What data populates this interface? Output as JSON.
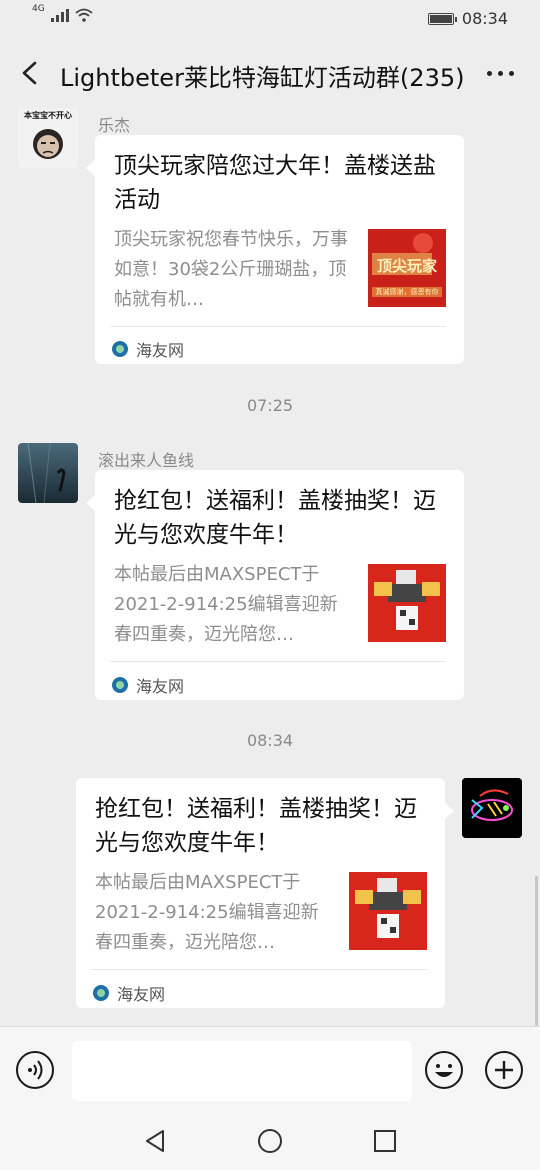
{
  "status": {
    "network": "4G",
    "time": "08:34"
  },
  "nav": {
    "title": "Lightbeter莱比特海缸灯活动群(235)"
  },
  "messages": [
    {
      "sender": "乐杰",
      "avatar_text": "本宝宝不开心",
      "card": {
        "title": "顶尖玩家陪您过大年！盖楼送盐活动",
        "desc": "顶尖玩家祝您春节快乐，万事如意！30袋2公斤珊瑚盐，顶帖就有机…",
        "thumb_text_top": "顶尖玩家",
        "thumb_text_bottom": "真诚感谢，感恩有你",
        "source": "海友网"
      }
    },
    {
      "sender": "滚出来人鱼线",
      "card": {
        "title": "抢红包！送福利！盖楼抽奖！迈光与您欢度牛年！",
        "desc": "本帖最后由MAXSPECT于2021-2-914:25编辑喜迎新春四重奏，迈光陪您…",
        "source": "海友网"
      }
    },
    {
      "sender": "",
      "card": {
        "title": "抢红包！送福利！盖楼抽奖！迈光与您欢度牛年！",
        "desc": "本帖最后由MAXSPECT于2021-2-914:25编辑喜迎新春四重奏，迈光陪您…",
        "source": "海友网"
      }
    }
  ],
  "timestamps": [
    "07:25",
    "08:34"
  ],
  "input": {
    "placeholder": ""
  },
  "colors": {
    "background": "#ededed",
    "card": "#ffffff",
    "thumb_red": "#d9261c"
  }
}
